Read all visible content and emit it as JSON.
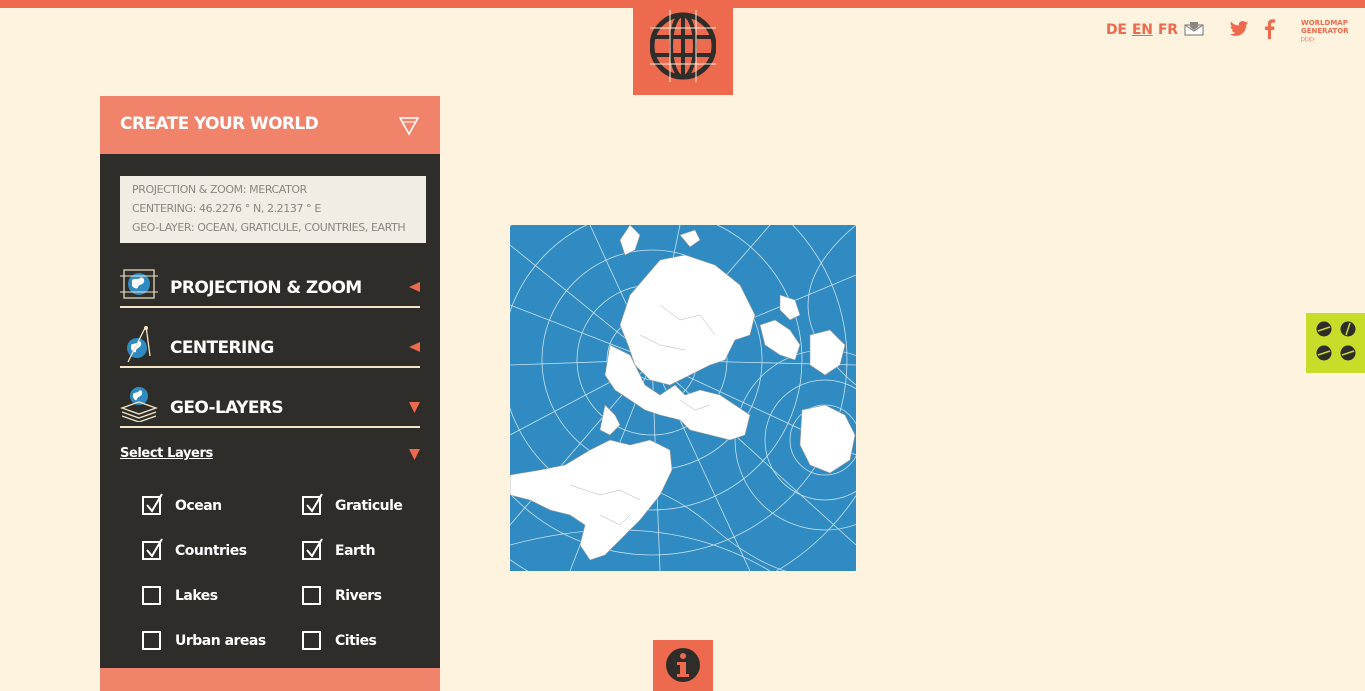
{
  "nav": {
    "languages": [
      {
        "code": "DE",
        "active": false
      },
      {
        "code": "EN",
        "active": true
      },
      {
        "code": "FR",
        "active": false
      }
    ],
    "icons": [
      "mail-icon",
      "twitter-icon",
      "facebook-icon"
    ],
    "brand_line1": "WORLDMAP",
    "brand_line2": "GENERATOR",
    "brand_arrows": "▷▷▷"
  },
  "panel": {
    "title": "CREATE YOUR WORLD",
    "summary": {
      "line1": "PROJECTION & ZOOM: MERCATOR",
      "line2": "CENTERING: 46.2276 ° N, 2.2137 ° E",
      "line3": "GEO-LAYER: OCEAN, GRATICULE, COUNTRIES, EARTH"
    },
    "sections": [
      {
        "label": "PROJECTION & ZOOM",
        "icon": "projection-globe-icon",
        "expanded": false
      },
      {
        "label": "CENTERING",
        "icon": "centering-compass-icon",
        "expanded": false
      },
      {
        "label": "GEO-LAYERS",
        "icon": "geo-layers-stack-icon",
        "expanded": true
      }
    ],
    "select_layers_label": "Select Layers",
    "layers": [
      {
        "label": "Ocean",
        "checked": true
      },
      {
        "label": "Graticule",
        "checked": true
      },
      {
        "label": "Countries",
        "checked": true
      },
      {
        "label": "Earth",
        "checked": true
      },
      {
        "label": "Lakes",
        "checked": false
      },
      {
        "label": "Rivers",
        "checked": false
      },
      {
        "label": "Urban areas",
        "checked": false
      },
      {
        "label": "Cities",
        "checked": false
      }
    ]
  },
  "colors": {
    "accent": "#ee6a4e",
    "panel_bg": "#2f2d29",
    "page_bg": "#fdf3df",
    "ocean": "#2f8bc1",
    "side_tab": "#c8dc2a"
  }
}
